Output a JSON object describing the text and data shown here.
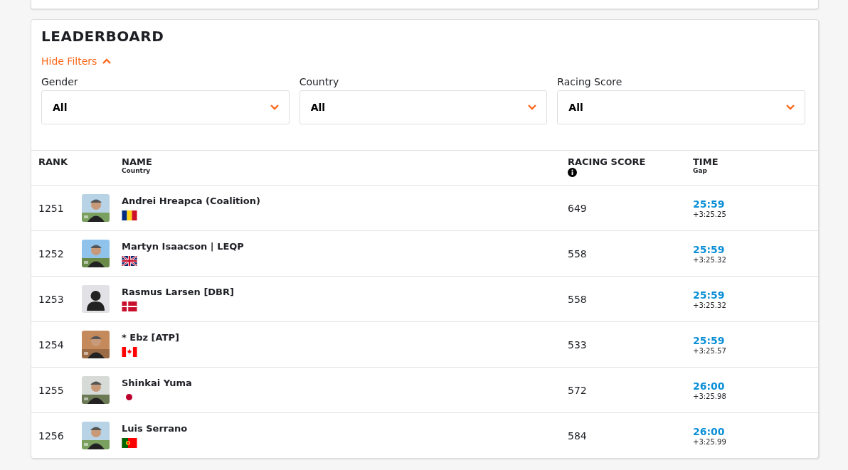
{
  "title": "LEADERBOARD",
  "filter_toggle": {
    "label": "Hide Filters",
    "expanded": true
  },
  "filters": [
    {
      "label": "Gender",
      "value": "All"
    },
    {
      "label": "Country",
      "value": "All"
    },
    {
      "label": "Racing Score",
      "value": "All"
    }
  ],
  "columns": {
    "rank": "RANK",
    "name": "NAME",
    "name_sub": "Country",
    "score": "RACING SCORE",
    "time": "TIME",
    "time_sub": "Gap"
  },
  "rows": [
    {
      "rank": "1251",
      "name": "Andrei Hreapca (Coalition)",
      "flag": {
        "kind": "ro"
      },
      "score": "649",
      "time": "25:59",
      "gap": "+3:25.25"
    },
    {
      "rank": "1252",
      "name": "Martyn Isaacson | LEQP",
      "flag": {
        "kind": "gb"
      },
      "score": "558",
      "time": "25:59",
      "gap": "+3:25.32"
    },
    {
      "rank": "1253",
      "name": "Rasmus Larsen [DBR]",
      "flag": {
        "kind": "dk"
      },
      "avatar": {
        "kind": "placeholder"
      },
      "score": "558",
      "time": "25:59",
      "gap": "+3:25.32"
    },
    {
      "rank": "1254",
      "name": "* Ebz [ATP]",
      "flag": {
        "kind": "ca"
      },
      "score": "533",
      "time": "25:59",
      "gap": "+3:25.57"
    },
    {
      "rank": "1255",
      "name": "Shinkai Yuma",
      "flag": {
        "kind": "jp"
      },
      "score": "572",
      "time": "26:00",
      "gap": "+3:25.98"
    },
    {
      "rank": "1256",
      "name": "Luis Serrano",
      "flag": {
        "kind": "pt"
      },
      "score": "584",
      "time": "26:00",
      "gap": "+3:25.99"
    }
  ]
}
